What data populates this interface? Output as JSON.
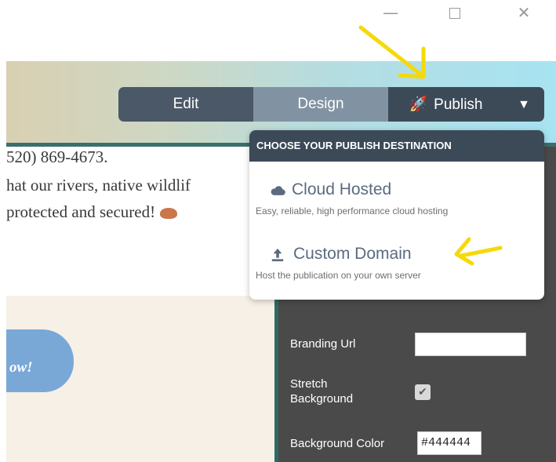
{
  "window": {
    "minimize_glyph": "—",
    "close_glyph": "✕"
  },
  "page": {
    "line1": "520) 869-4673.",
    "line2": "hat our rivers, native wildlif",
    "line3": "protected and secured!",
    "badge_text": "ow!"
  },
  "toolbar": {
    "edit_label": "Edit",
    "design_label": "Design",
    "publish_label": "Publish",
    "caret_glyph": "▼",
    "rocket_glyph": "🚀"
  },
  "publish_menu": {
    "header": "CHOOSE YOUR PUBLISH DESTINATION",
    "options": [
      {
        "title": "Cloud Hosted",
        "subtitle": "Easy, reliable, high performance cloud hosting"
      },
      {
        "title": "Custom Domain",
        "subtitle": "Host the publication on your own server"
      }
    ]
  },
  "settings_panel": {
    "branding_url_label": "Branding Url",
    "branding_url_value": "",
    "stretch_background_label": "Stretch Background",
    "stretch_background_checked": true,
    "background_color_label": "Background Color",
    "background_color_value": "#444444"
  },
  "colors": {
    "toolbar_dark": "#3c4a58",
    "toolbar_edit": "#4b5867",
    "toolbar_design": "#8193a3",
    "annotation_arrow": "#f5d90a",
    "panel_bg": "#4a4a4a"
  }
}
